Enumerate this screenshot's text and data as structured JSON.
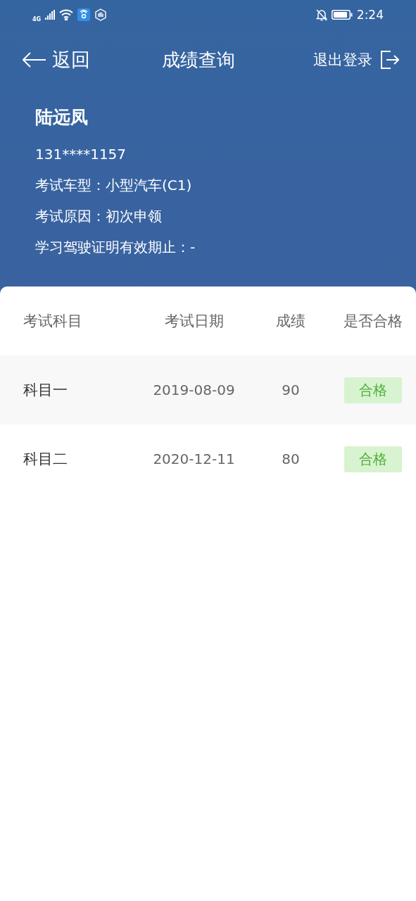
{
  "status_bar": {
    "network": "4G",
    "time": "2:24"
  },
  "nav": {
    "back": "返回",
    "title": "成绩查询",
    "logout": "退出登录"
  },
  "profile": {
    "name": "陆远凤",
    "phone": "131****1157",
    "lines": [
      "考试车型：小型汽车(C1)",
      "考试原因：初次申领",
      "学习驾驶证明有效期止：-"
    ]
  },
  "table": {
    "columns": [
      "考试科目",
      "考试日期",
      "成绩",
      "是否合格"
    ],
    "rows": [
      {
        "subject": "科目一",
        "date": "2019-08-09",
        "score": "90",
        "result": "合格",
        "passed": true
      },
      {
        "subject": "科目二",
        "date": "2020-12-11",
        "score": "80",
        "result": "合格",
        "passed": true
      }
    ]
  }
}
